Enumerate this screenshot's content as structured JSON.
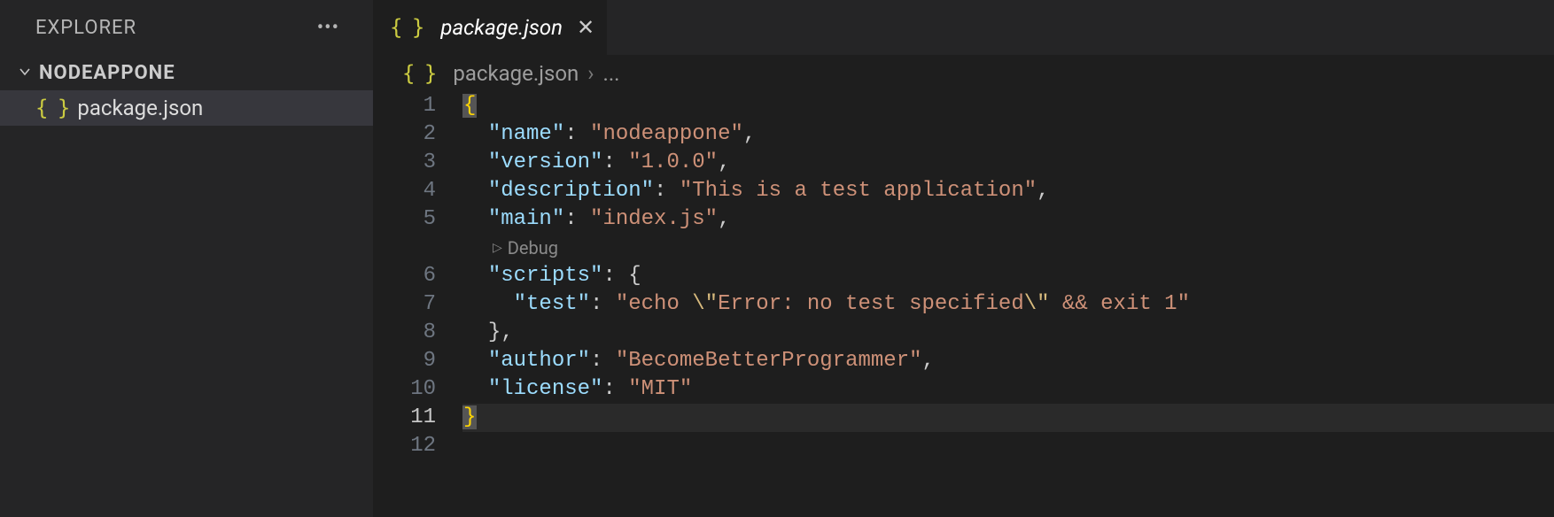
{
  "sidebar": {
    "title": "EXPLORER",
    "folder": "NODEAPPONE",
    "files": [
      {
        "name": "package.json"
      }
    ]
  },
  "tab": {
    "filename": "package.json"
  },
  "breadcrumb": {
    "filename": "package.json",
    "tail": "..."
  },
  "codelens": {
    "label": "Debug"
  },
  "line_numbers": [
    "1",
    "2",
    "3",
    "4",
    "5",
    "6",
    "7",
    "8",
    "9",
    "10",
    "11",
    "12"
  ],
  "code": {
    "l2_key": "\"name\"",
    "l2_val": "\"nodeappone\"",
    "l3_key": "\"version\"",
    "l3_val": "\"1.0.0\"",
    "l4_key": "\"description\"",
    "l4_val": "\"This is a test application\"",
    "l5_key": "\"main\"",
    "l5_val": "\"index.js\"",
    "l6_key": "\"scripts\"",
    "l7_key": "\"test\"",
    "l7_val_a": "\"echo ",
    "l7_esc1": "\\\"",
    "l7_val_b": "Error: no test specified",
    "l7_esc2": "\\\"",
    "l7_val_c": " && exit 1\"",
    "l9_key": "\"author\"",
    "l9_val": "\"BecomeBetterProgrammer\"",
    "l10_key": "\"license\"",
    "l10_val": "\"MIT\""
  }
}
